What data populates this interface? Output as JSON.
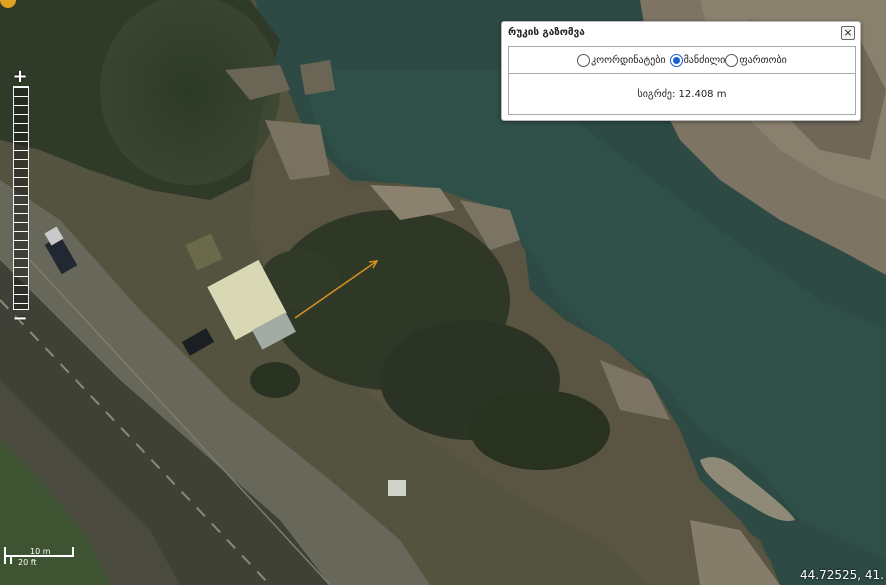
{
  "map": {
    "type": "satellite imagery",
    "measure_line_color": "#d6921e",
    "water_color": "#2d4a44"
  },
  "zoom": {
    "in_label": "+",
    "out_label": "−"
  },
  "scale": {
    "metric": "10 m",
    "imperial": "20 ft"
  },
  "coordinates": "44.72525, 41.",
  "measure_panel": {
    "title": "რუკის გაზომვა",
    "close_label": "×",
    "options": [
      {
        "label": "კოორდინატები",
        "checked": false
      },
      {
        "label": "მანძილი",
        "checked": true
      },
      {
        "label": "ფართობი",
        "checked": false
      }
    ],
    "result": "სიგრძე: 12.408 m"
  }
}
